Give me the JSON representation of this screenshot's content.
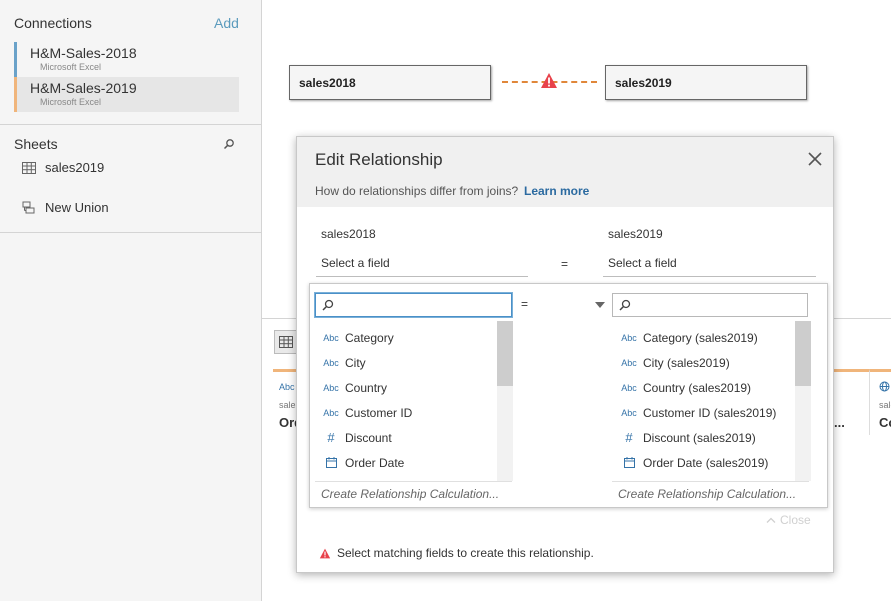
{
  "connections": {
    "title": "Connections",
    "add_label": "Add",
    "items": [
      {
        "name": "H&M-Sales-2018",
        "type": "Microsoft Excel",
        "color": "#6aa2c9"
      },
      {
        "name": "H&M-Sales-2019",
        "type": "Microsoft Excel",
        "color": "#f0b57b"
      }
    ]
  },
  "sheets": {
    "title": "Sheets",
    "items": [
      {
        "label": "sales2019",
        "icon": "table-icon"
      },
      {
        "label": "New Union",
        "icon": "union-icon"
      }
    ]
  },
  "canvas": {
    "left_table": "sales2018",
    "right_table": "sales2019",
    "relationship_status": "warning"
  },
  "dialog": {
    "title": "Edit Relationship",
    "question": "How do relationships differ from joins?",
    "learn_more": "Learn more",
    "left_source": "sales2018",
    "right_source": "sales2019",
    "left_field_placeholder": "Select a field",
    "right_field_placeholder": "Select a field",
    "operator": "=",
    "picker": {
      "operator": "=",
      "left_search_value": "",
      "right_search_value": "",
      "left_fields": [
        {
          "label": "Category",
          "type": "Abc"
        },
        {
          "label": "City",
          "type": "Abc"
        },
        {
          "label": "Country",
          "type": "Abc"
        },
        {
          "label": "Customer ID",
          "type": "Abc"
        },
        {
          "label": "Discount",
          "type": "#"
        },
        {
          "label": "Order Date",
          "type": "date"
        }
      ],
      "right_fields": [
        {
          "label": "Category (sales2019)",
          "type": "Abc"
        },
        {
          "label": "City (sales2019)",
          "type": "Abc"
        },
        {
          "label": "Country (sales2019)",
          "type": "Abc"
        },
        {
          "label": "Customer ID (sales2019)",
          "type": "Abc"
        },
        {
          "label": "Discount (sales2019)",
          "type": "#"
        },
        {
          "label": "Order Date (sales2019)",
          "type": "date"
        }
      ],
      "calc_link": "Create Relationship Calculation...",
      "close_label": "Close"
    },
    "warning": "Select matching fields to create this relationship."
  },
  "background": {
    "col_labels": [
      "Abc",
      "sale",
      "Ord",
      "...",
      "Co"
    ]
  },
  "colors": {
    "accent_blue": "#6aa2c9",
    "accent_orange": "#f0b57b",
    "warning_red": "#e8424b",
    "link_blue": "#2b6aa0"
  }
}
